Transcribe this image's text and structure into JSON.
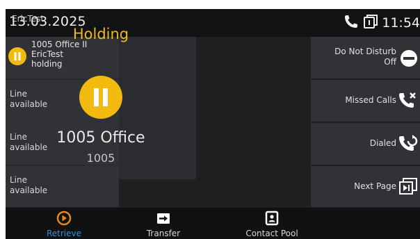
{
  "status_bar": {
    "date": "13.03.2025",
    "time": "11:54",
    "icons": [
      "phone-icon",
      "voicemail-icon"
    ]
  },
  "lines": [
    {
      "name": "1005 Office II",
      "caller": "EricTest",
      "state": "holding",
      "icon": "pause-icon",
      "status_color": "#f2b90f"
    },
    {
      "label_line1": "Line",
      "label_line2": "available"
    },
    {
      "label_line1": "Line",
      "label_line2": "available"
    },
    {
      "label_line1": "Line",
      "label_line2": "available"
    }
  ],
  "call": {
    "caller_id": "EricTest",
    "state": "Holding",
    "contact_name": "1005 Office",
    "contact_number": "1005",
    "accent_color": "#f2b90f"
  },
  "right_keys": [
    {
      "label_line1": "Do Not Disturb",
      "label_line2": "Off",
      "icon": "do-not-disturb-icon"
    },
    {
      "label": "Missed Calls",
      "icon": "missed-call-icon"
    },
    {
      "label": "Dialed",
      "icon": "dialed-call-icon"
    },
    {
      "label": "Next Page",
      "icon": "next-page-icon"
    }
  ],
  "softkeys": [
    {
      "label": "Retrieve",
      "icon": "retrieve-icon",
      "color": "#e68a1a"
    },
    {
      "label": "Transfer",
      "icon": "transfer-icon"
    },
    {
      "label": "Contact Pool",
      "icon": "contact-pool-icon"
    }
  ]
}
